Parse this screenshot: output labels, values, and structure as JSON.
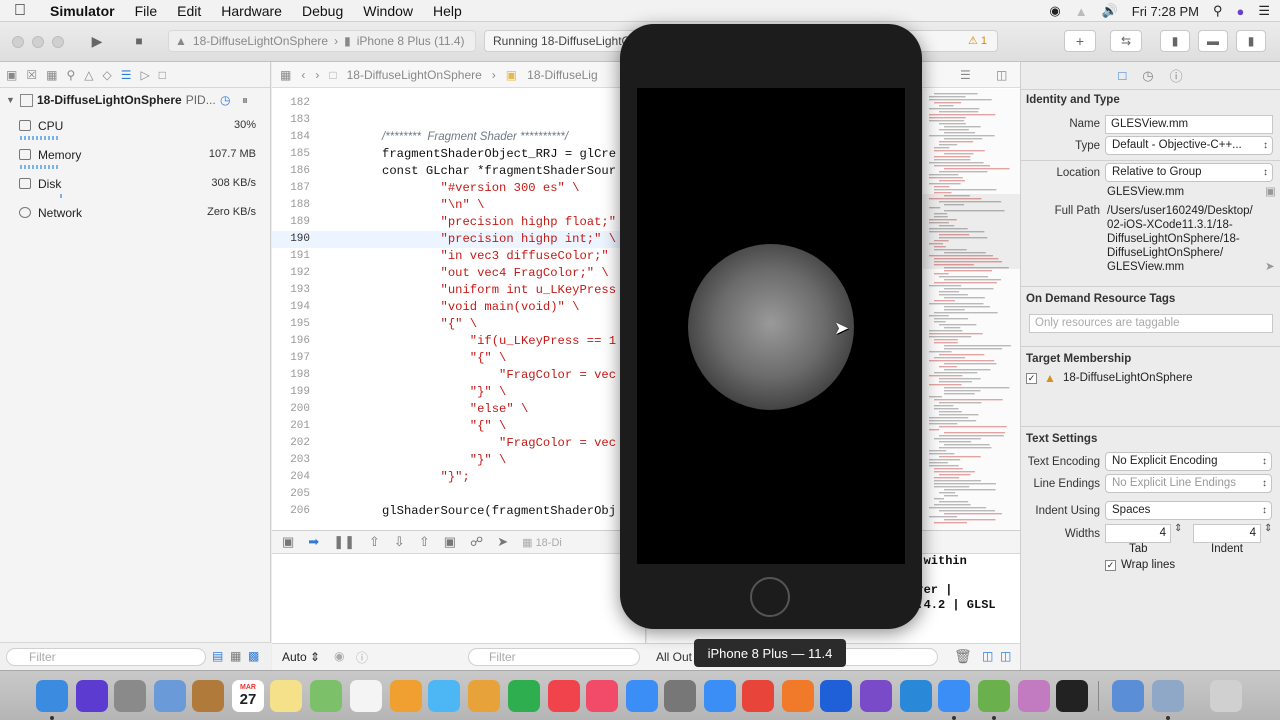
{
  "menubar": {
    "app": "Simulator",
    "items": [
      "File",
      "Edit",
      "Hardware",
      "Debug",
      "Window",
      "Help"
    ],
    "clock": "Fri 7:28 PM"
  },
  "toolbar": {
    "scheme": "18-DiffuseLightOnSphere",
    "destination": "iPhone 8 Plus (11.4)",
    "status": "Running 18-DiffuseLightO",
    "warnings": "1"
  },
  "navigator": {
    "process_name": "18-DiffuseLightOnSphere",
    "process_pid": "PID...",
    "gauges": [
      {
        "name": "CPU",
        "value": "30%"
      },
      {
        "name": "Memory",
        "value": "107.7 MB"
      },
      {
        "name": "Disk",
        "value": "308 KB/s"
      },
      {
        "name": "Network",
        "value": "Zero KB/s"
      }
    ],
    "filter_placeholder": "Filter"
  },
  "editor": {
    "breadcrumb": [
      "18-DiffuseLightOnSphere",
      "18-DiffuseLig"
    ],
    "lines": [
      {
        "n": "182",
        "t": ""
      },
      {
        "n": "183",
        "t": ""
      },
      {
        "n": "184",
        "t": "/********  Fragment Shader **********/"
      },
      {
        "n": "185",
        "t": "fragmentShaderObject_RRJ = glCre"
      },
      {
        "n": "186",
        "t": "const GLchar *fragmentShaderSour"
      },
      {
        "n": "187",
        "t": "        \"#version 300 es\" \\"
      },
      {
        "n": "188",
        "t": "        \"\\n\" \\"
      },
      {
        "n": "189",
        "t": "        \"precision highp float;\""
      },
      {
        "n": "190",
        "t": "        \"precision highp int;\" \\"
      },
      {
        "n": "191",
        "t": "        \"in vec3 diffuseColor;\""
      },
      {
        "n": "192",
        "t": "        \"out vec4 FragColor;\" \\"
      },
      {
        "n": "193",
        "t": "        \"uniform int u_LKeyPress"
      },
      {
        "n": "194",
        "t": "        \"void main(void)\" \\"
      },
      {
        "n": "195",
        "t": "        \"{\" \\"
      },
      {
        "n": "196",
        "t": "            \"if(u_LKeyPress == 1"
      },
      {
        "n": "197",
        "t": "            \"{\" \\"
      },
      {
        "n": "198",
        "t": "                \"FragColor = vec"
      },
      {
        "n": "199",
        "t": "            \"}\" \\"
      },
      {
        "n": "200",
        "t": "            \"else\" \\"
      },
      {
        "n": "201",
        "t": "            \"{\" \\"
      },
      {
        "n": "202",
        "t": "                \"FragColor = vec"
      },
      {
        "n": "203",
        "t": "            \"}\" \\"
      },
      {
        "n": "204",
        "t": "        \"}\";"
      },
      {
        "n": "205",
        "t": ""
      },
      {
        "n": "206",
        "t": "glShaderSource(fragmentShaderObj"
      }
    ],
    "current_line": "190"
  },
  "debug": {
    "frame_label": "18-Di",
    "auto_label": "Auto",
    "filter_placeholder": "Filter",
    "output_label": "All Out",
    "console_lines": [
      "ed within",
      "",
      "derer |",
      "16.4.2 | GLSL"
    ]
  },
  "inspector": {
    "identity_title": "Identity and Type",
    "name_label": "Name",
    "name_value": "GLESView.mm",
    "type_label": "Type",
    "type_value": "Default - Objective-C++...",
    "location_label": "Location",
    "location_value": "Relative to Group",
    "location_file": "GLESView.mm",
    "fullpath_label": "Full Path",
    "fullpath_lines": [
      "/Users/user160249/Desktop/",
      "02-iOS-XCode11.3.1/18-",
      "DiffuseLightOnSphere/18-",
      "DiffuseLightOnSphere/",
      "GLESView.mm"
    ],
    "odr_title": "On Demand Resource Tags",
    "odr_placeholder": "Only resources are taggable",
    "target_title": "Target Membership",
    "target_name": "18-DiffuseLightOnSphere",
    "text_title": "Text Settings",
    "encoding_label": "Text Encoding",
    "encoding_value": "No Explicit Encoding",
    "endings_label": "Line Endings",
    "endings_value": "No Explicit Line Endings",
    "indent_label": "Indent Using",
    "indent_value": "Spaces",
    "widths_label": "Widths",
    "tab_value": "4",
    "indent_width_value": "4",
    "tab_caption": "Tab",
    "indent_caption": "Indent",
    "wrap_label": "Wrap lines"
  },
  "simulator": {
    "device_label": "iPhone 8 Plus — 11.4"
  },
  "dock": {
    "calendar_month": "MAR",
    "calendar_day": "27"
  }
}
